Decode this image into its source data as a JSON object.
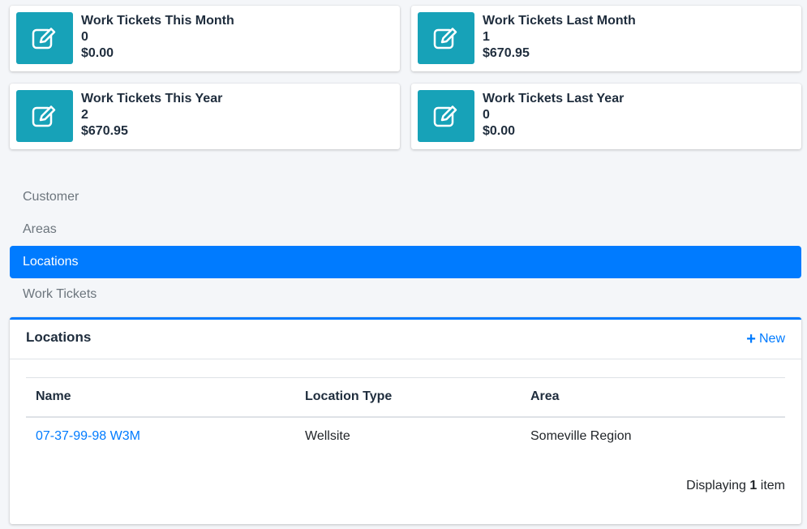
{
  "info_boxes": [
    {
      "title": "Work Tickets This Month",
      "count": "0",
      "amount": "$0.00",
      "icon": "edit-icon"
    },
    {
      "title": "Work Tickets Last Month",
      "count": "1",
      "amount": "$670.95",
      "icon": "edit-icon"
    },
    {
      "title": "Work Tickets This Year",
      "count": "2",
      "amount": "$670.95",
      "icon": "edit-icon"
    },
    {
      "title": "Work Tickets Last Year",
      "count": "0",
      "amount": "$0.00",
      "icon": "edit-icon"
    }
  ],
  "nav": {
    "items": [
      {
        "label": "Customer"
      },
      {
        "label": "Areas"
      },
      {
        "label": "Locations",
        "active": true
      },
      {
        "label": "Work Tickets"
      }
    ]
  },
  "locations_card": {
    "title": "Locations",
    "new_icon": "plus-icon",
    "new_label": "New",
    "columns": [
      "Name",
      "Location Type",
      "Area"
    ],
    "rows": [
      {
        "name": "07-37-99-98 W3M",
        "type": "Wellsite",
        "area": "Someville Region"
      }
    ],
    "pager": {
      "prefix": "Displaying",
      "count": "1",
      "suffix": "item"
    }
  },
  "colors": {
    "icon_bg": "#17a2b8",
    "primary": "#007bff"
  }
}
